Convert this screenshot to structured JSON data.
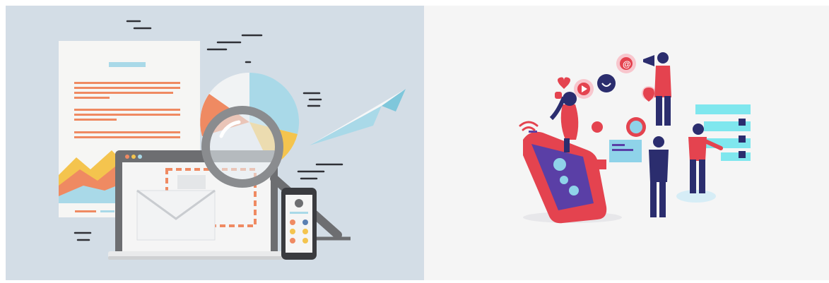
{
  "panels": [
    {
      "subject": "email-marketing-illustration",
      "background": "#d3dde6",
      "accent": "#ef8a62"
    },
    {
      "subject": "social-media-marketing-illustration",
      "background": "#f5f5f5",
      "accent": "#e4434f"
    }
  ],
  "colors": {
    "orange": "#ef8a62",
    "sky": "#a9d9e8",
    "grey": "#6d6e71",
    "navy": "#2b2d6e",
    "red": "#e4434f",
    "purple": "#5a3fa6",
    "cyan": "#7fe7ee"
  }
}
